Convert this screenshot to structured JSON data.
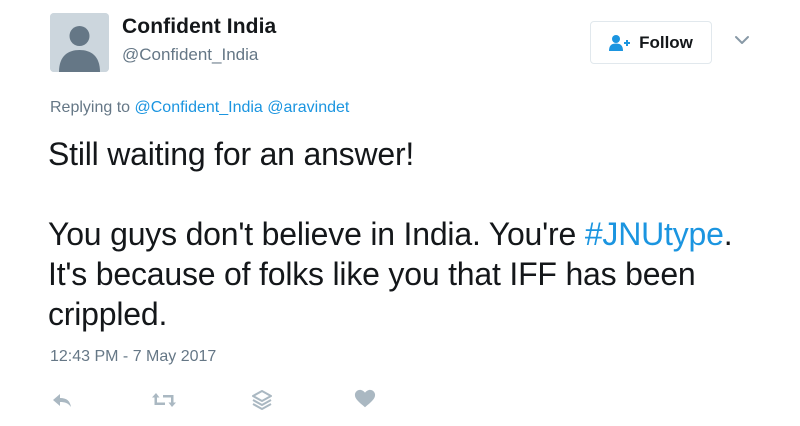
{
  "user": {
    "display_name": "Confident India",
    "handle": "@Confident_India"
  },
  "follow_button": {
    "label": "Follow"
  },
  "reply_context": {
    "prefix": "Replying to ",
    "mentions": [
      "@Confident_India",
      "@aravindet"
    ]
  },
  "tweet": {
    "line1": "Still waiting for an answer!",
    "para2_part1": "You guys don't believe in India. You're ",
    "hashtag": "#JNUtype",
    "para2_part2": ". It's because of folks like you that IFF has been crippled."
  },
  "timestamp": "12:43 PM - 7 May 2017",
  "actions": {
    "icons": [
      "reply-icon",
      "retweet-icon",
      "stack-icon",
      "heart-icon"
    ]
  },
  "colors": {
    "link": "#1b95e0",
    "muted": "#657786",
    "text": "#14171a",
    "icon": "#aab8c2",
    "border": "#e1e8ed"
  }
}
